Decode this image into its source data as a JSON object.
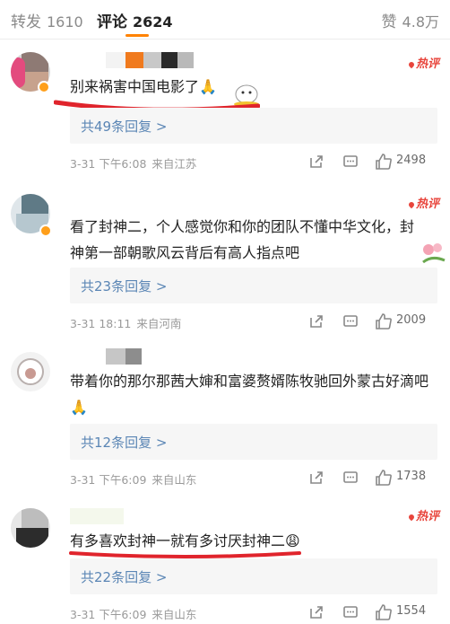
{
  "tabs": {
    "reposts_label": "转发",
    "reposts_count": "1610",
    "comments_label": "评论",
    "comments_count": "2624",
    "likes_label": "赞",
    "likes_count": "4.8万",
    "accent_color": "#ff8200"
  },
  "comments": [
    {
      "text": "别来祸害中国电影了🙏",
      "hot_label": "热评",
      "replies_label": "共49条回复 >",
      "date": "3-31 下午6:08",
      "location": "来自江苏",
      "likes": "2498",
      "verified": true
    },
    {
      "text": "看了封神二，个人感觉你和你的团队不懂中华文化，封神第一部朝歌风云背后有高人指点吧",
      "hot_label": "热评",
      "replies_label": "共23条回复 >",
      "date": "3-31 18:11",
      "location": "来自河南",
      "likes": "2009",
      "verified": true
    },
    {
      "text": "带着你的那尔那茜大婶和富婆赘婿陈牧驰回外蒙古好滴吧🙏",
      "hot_label": "",
      "replies_label": "共12条回复 >",
      "date": "3-31 下午6:09",
      "location": "来自山东",
      "likes": "1738",
      "verified": false
    },
    {
      "text": "有多喜欢封神一就有多讨厌封神二😩",
      "hot_label": "热评",
      "replies_label": "共22条回复 >",
      "date": "3-31 下午6:09",
      "location": "来自山东",
      "likes": "1554",
      "verified": false
    }
  ],
  "icons": {
    "share": "share-icon",
    "comment": "comment-icon",
    "like": "thumbs-up-icon",
    "hot": "hot-comment-badge"
  },
  "colors": {
    "link": "#5b86b5",
    "hot": "#e8453c",
    "markup_red": "#e0242c",
    "reply_bg": "#f6f6f6"
  }
}
